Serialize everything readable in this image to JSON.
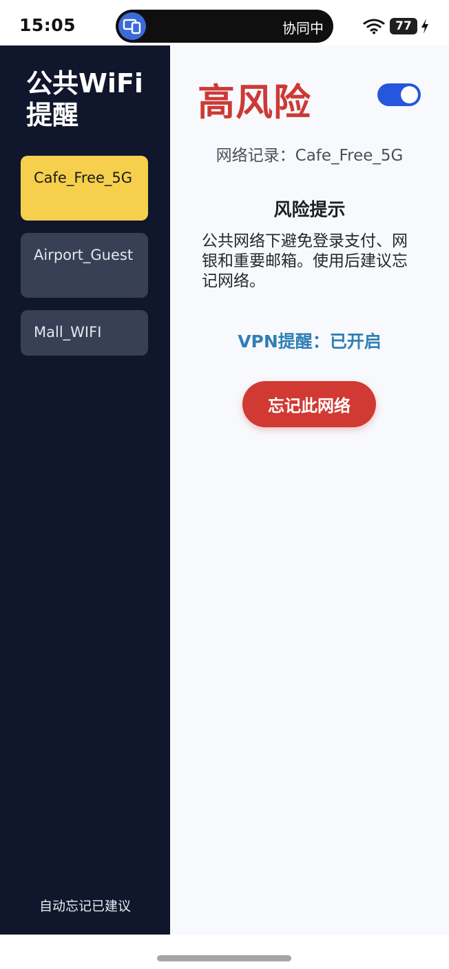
{
  "status_bar": {
    "time": "15:05",
    "island_text": "协同中",
    "island_icon": "multi-device-icon",
    "battery": "77",
    "wifi_icon": "wifi-icon",
    "charging_icon": "bolt-icon"
  },
  "sidebar": {
    "title": "公共WiFi提醒",
    "networks": [
      {
        "label": "Cafe_Free_5G",
        "active": true
      },
      {
        "label": "Airport_Guest",
        "active": false
      },
      {
        "label": "Mall_WIFI",
        "active": false
      }
    ],
    "footer": "自动忘记已建议"
  },
  "main": {
    "risk_level": "高风险",
    "toggle_on": true,
    "record_line": "网络记录：Cafe_Free_5G",
    "tip_title": "风险提示",
    "tip_body": "公共网络下避免登录支付、网银和重要邮箱。使用后建议忘记网络。",
    "vpn_line": "VPN提醒：已开启",
    "forget_button": "忘记此网络"
  },
  "colors": {
    "sidebar_bg": "#10162b",
    "active_item": "#f6cf4c",
    "inactive_item": "#374055",
    "risk_red": "#cc3a36",
    "toggle_blue": "#2556de",
    "vpn_blue": "#2f7fb5",
    "button_red": "#d03a33"
  }
}
